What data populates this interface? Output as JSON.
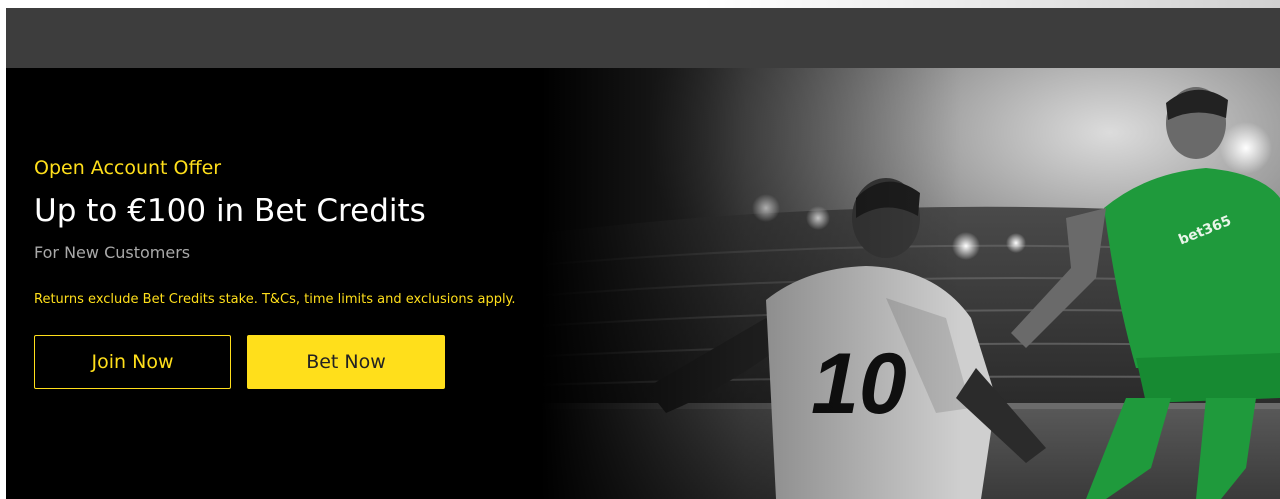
{
  "promo": {
    "eyebrow": "Open Account Offer",
    "headline": "Up to €100 in Bet Credits",
    "subheadline": "For New Customers",
    "terms": "Returns exclude Bet Credits stake. T&Cs, time limits and exclusions apply."
  },
  "buttons": {
    "join_label": "Join Now",
    "bet_label": "Bet Now"
  },
  "hero_image": {
    "jersey_number": "10",
    "shirt_sponsor": "bet365"
  },
  "colors": {
    "accent": "#ffdf1b",
    "header_bar": "#3d3d3d",
    "hero_background": "#000000",
    "player_kit_green": "#1f9a3c",
    "subheadline_grey": "#a9a9a9"
  }
}
